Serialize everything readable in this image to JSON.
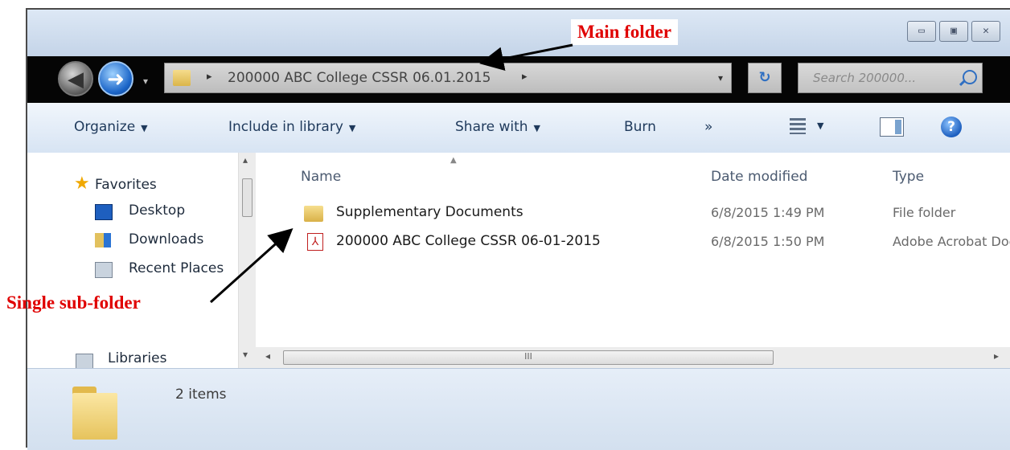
{
  "window": {
    "controls": {
      "minimize": "▭",
      "maximize": "▣",
      "close": "✕"
    }
  },
  "navigation": {
    "address_path": "200000 ABC College CSSR 06.01.2015",
    "separator": "▸",
    "dropdown_arrow": "▾",
    "refresh_symbol": "↻",
    "search_placeholder": "Search 200000..."
  },
  "toolbar": {
    "organize": "Organize",
    "include_in_library": "Include in library",
    "share_with": "Share with",
    "burn": "Burn",
    "more": "»",
    "arrow": "▼",
    "help": "?"
  },
  "nav_pane": {
    "favorites": "Favorites",
    "items": [
      "Desktop",
      "Downloads",
      "Recent Places"
    ],
    "libraries": "Libraries"
  },
  "columns": {
    "name": "Name",
    "date_modified": "Date modified",
    "type": "Type"
  },
  "files": [
    {
      "name": "Supplementary Documents",
      "date": "6/8/2015 1:49 PM",
      "type": "File folder",
      "icon": "folder-icon"
    },
    {
      "name": "200000 ABC College CSSR 06-01-2015",
      "date": "6/8/2015 1:50 PM",
      "type": "Adobe Acrobat Document",
      "icon": "pdf-icon"
    }
  ],
  "scrollbar": {
    "grip": "III",
    "left": "◂",
    "right": "▸",
    "up": "▴",
    "down": "▾"
  },
  "details": {
    "item_count": "2 items"
  },
  "annotations": {
    "main_folder": "Main folder",
    "single_subfolder": "Single sub-folder"
  },
  "colors": {
    "annotation": "#e00000",
    "navbar": "#050505",
    "toolbar": "#dbe6f4"
  }
}
